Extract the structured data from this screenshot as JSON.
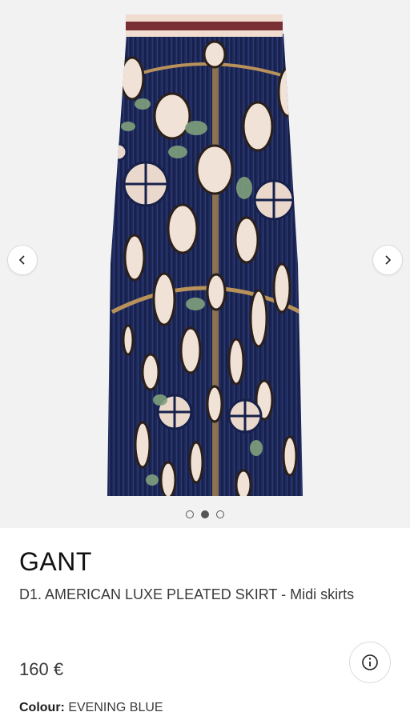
{
  "gallery": {
    "image_description_icon": "pleated-skirt-product-image",
    "prev_icon": "chevron-left-icon",
    "next_icon": "chevron-right-icon",
    "dots": [
      {
        "active": false
      },
      {
        "active": true
      },
      {
        "active": false
      }
    ]
  },
  "product": {
    "brand": "GANT",
    "title": "D1. AMERICAN LUXE PLEATED SKIRT - Midi skirts",
    "price": "160 €",
    "colour_label": "Colour:",
    "colour_value": "EVENING BLUE",
    "info_icon": "info-icon"
  },
  "colors": {
    "skirt_navy": "#1f2a5c",
    "waistband_burgundy": "#7a2f35",
    "waistband_cream": "#f1dcd2",
    "gallery_bg": "#f2f2f2"
  }
}
